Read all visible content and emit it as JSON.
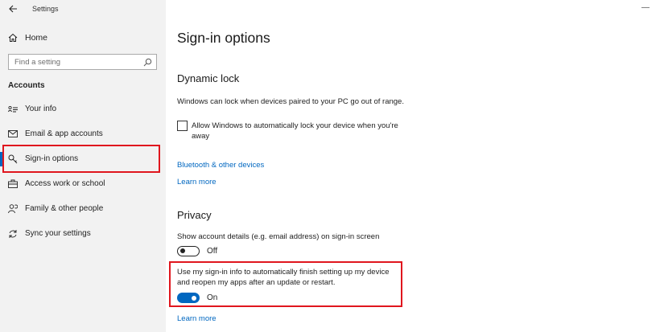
{
  "window": {
    "title": "Settings",
    "minimize_glyph": "—"
  },
  "sidebar": {
    "home_label": "Home",
    "search_placeholder": "Find a setting",
    "section_title": "Accounts",
    "items": [
      {
        "label": "Your info",
        "icon": "person-card-icon"
      },
      {
        "label": "Email & app accounts",
        "icon": "mail-icon"
      },
      {
        "label": "Sign-in options",
        "icon": "key-icon",
        "selected": true
      },
      {
        "label": "Access work or school",
        "icon": "briefcase-icon"
      },
      {
        "label": "Family & other people",
        "icon": "people-icon"
      },
      {
        "label": "Sync your settings",
        "icon": "sync-icon"
      }
    ]
  },
  "main": {
    "title": "Sign-in options",
    "dynamic_lock": {
      "heading": "Dynamic lock",
      "description": "Windows can lock when devices paired to your PC go out of range.",
      "checkbox_label": "Allow Windows to automatically lock your device when you're away",
      "checkbox_checked": false,
      "link_bluetooth": "Bluetooth & other devices",
      "link_learn_more": "Learn more"
    },
    "privacy": {
      "heading": "Privacy",
      "account_details_text": "Show account details (e.g. email address) on sign-in screen",
      "account_details_state": "Off",
      "signin_info_text": "Use my sign-in info to automatically finish setting up my device and reopen my apps after an update or restart.",
      "signin_info_state": "On",
      "link_learn_more": "Learn more"
    }
  },
  "colors": {
    "accent": "#0067c0",
    "highlight": "#e0161e",
    "sidebar_bg": "#f2f2f2"
  }
}
